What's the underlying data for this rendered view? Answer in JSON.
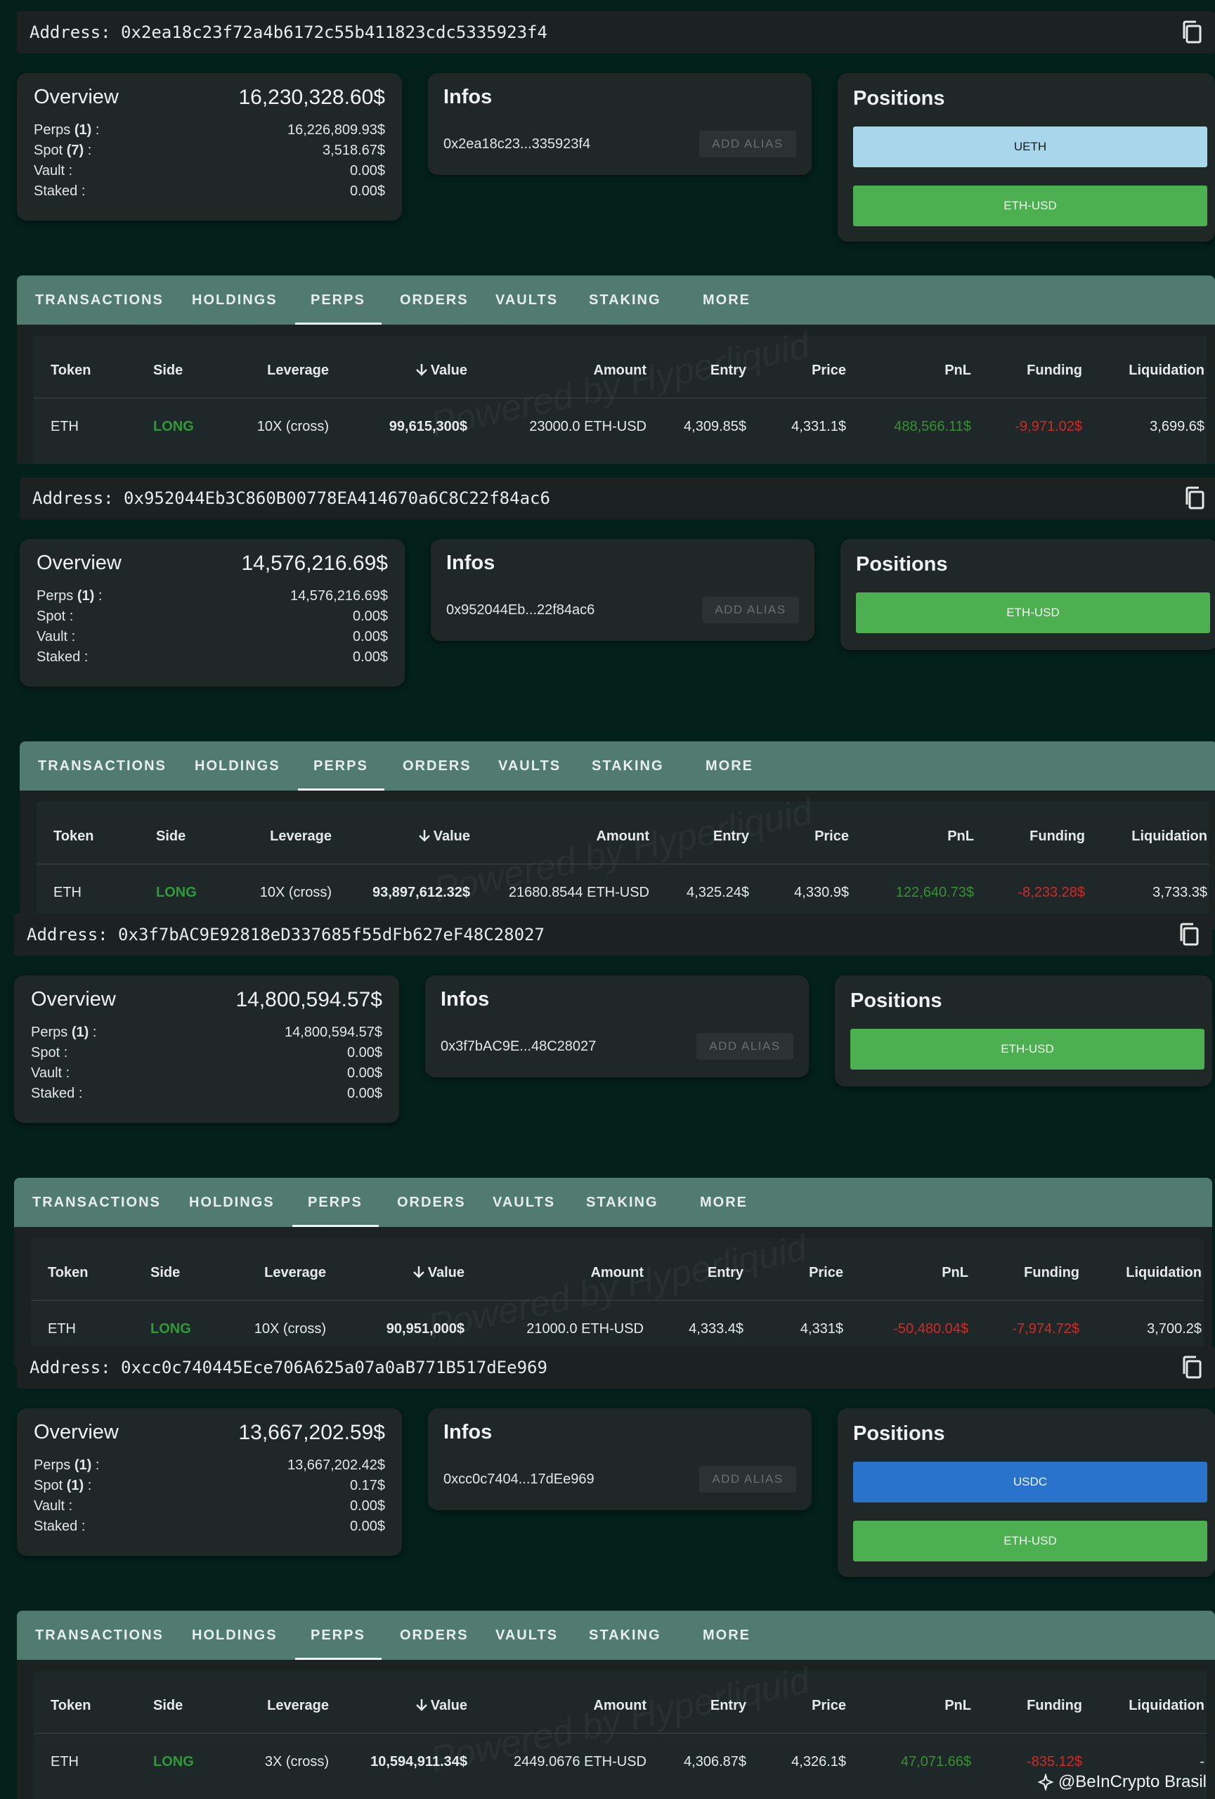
{
  "blocks": [
    {
      "address_line": "Address: 0x2ea18c23f72a4b6172c55b411823cdc5335923f4",
      "overview": {
        "title": "Overview",
        "total": "16,230,328.60$",
        "rows": [
          {
            "name": "Perps",
            "count": "(1)",
            "suffix": " :",
            "value": "16,226,809.93$"
          },
          {
            "name": "Spot",
            "count": "(7)",
            "suffix": " :",
            "value": "3,518.67$"
          },
          {
            "name": "Vault",
            "count": "",
            "suffix": " :",
            "value": "0.00$"
          },
          {
            "name": "Staked",
            "count": "",
            "suffix": " :",
            "value": "0.00$"
          }
        ]
      },
      "infos": {
        "title": "Infos",
        "short_address": "0x2ea18c23...335923f4",
        "alias_button": "ADD ALIAS"
      },
      "positions": {
        "title": "Positions",
        "items": [
          {
            "label": "UETH",
            "color": "#a8d6ea",
            "text_color": "#1a1a1a"
          },
          {
            "label": "ETH-USD",
            "color": "#4caf50",
            "text_color": "#f4f7f4"
          }
        ]
      },
      "row": {
        "token": "ETH",
        "side": "LONG",
        "leverage": "10X (cross)",
        "value": "99,615,300$",
        "amount": "23000.0 ETH-USD",
        "entry": "4,309.85$",
        "price": "4,331.1$",
        "pnl": "488,566.11$",
        "pnl_sign": "positive",
        "funding": "-9,971.02$",
        "liquidation": "3,699.6$"
      }
    },
    {
      "address_line": "Address: 0x952044Eb3C860B00778EA414670a6C8C22f84ac6",
      "overview": {
        "title": "Overview",
        "total": "14,576,216.69$",
        "rows": [
          {
            "name": "Perps",
            "count": "(1)",
            "suffix": " :",
            "value": "14,576,216.69$"
          },
          {
            "name": "Spot",
            "count": "",
            "suffix": " :",
            "value": "0.00$"
          },
          {
            "name": "Vault",
            "count": "",
            "suffix": " :",
            "value": "0.00$"
          },
          {
            "name": "Staked",
            "count": "",
            "suffix": " :",
            "value": "0.00$"
          }
        ]
      },
      "infos": {
        "title": "Infos",
        "short_address": "0x952044Eb...22f84ac6",
        "alias_button": "ADD ALIAS"
      },
      "positions": {
        "title": "Positions",
        "items": [
          {
            "label": "ETH-USD",
            "color": "#4caf50",
            "text_color": "#f4f7f4"
          }
        ]
      },
      "row": {
        "token": "ETH",
        "side": "LONG",
        "leverage": "10X (cross)",
        "value": "93,897,612.32$",
        "amount": "21680.8544 ETH-USD",
        "entry": "4,325.24$",
        "price": "4,330.9$",
        "pnl": "122,640.73$",
        "pnl_sign": "positive",
        "funding": "-8,233.28$",
        "liquidation": "3,733.3$"
      }
    },
    {
      "address_line": "Address: 0x3f7bAC9E92818eD337685f55dFb627eF48C28027",
      "overview": {
        "title": "Overview",
        "total": "14,800,594.57$",
        "rows": [
          {
            "name": "Perps",
            "count": "(1)",
            "suffix": " :",
            "value": "14,800,594.57$"
          },
          {
            "name": "Spot",
            "count": "",
            "suffix": " :",
            "value": "0.00$"
          },
          {
            "name": "Vault",
            "count": "",
            "suffix": " :",
            "value": "0.00$"
          },
          {
            "name": "Staked",
            "count": "",
            "suffix": " :",
            "value": "0.00$"
          }
        ]
      },
      "infos": {
        "title": "Infos",
        "short_address": "0x3f7bAC9E...48C28027",
        "alias_button": "ADD ALIAS"
      },
      "positions": {
        "title": "Positions",
        "items": [
          {
            "label": "ETH-USD",
            "color": "#4caf50",
            "text_color": "#f4f7f4"
          }
        ]
      },
      "row": {
        "token": "ETH",
        "side": "LONG",
        "leverage": "10X (cross)",
        "value": "90,951,000$",
        "amount": "21000.0 ETH-USD",
        "entry": "4,333.4$",
        "price": "4,331$",
        "pnl": "-50,480.04$",
        "pnl_sign": "negative",
        "funding": "-7,974.72$",
        "liquidation": "3,700.2$"
      }
    },
    {
      "address_line": "Address: 0xcc0c740445Ece706A625a07a0aB771B517dEe969",
      "overview": {
        "title": "Overview",
        "total": "13,667,202.59$",
        "rows": [
          {
            "name": "Perps",
            "count": "(1)",
            "suffix": " :",
            "value": "13,667,202.42$"
          },
          {
            "name": "Spot",
            "count": "(1)",
            "suffix": " :",
            "value": "0.17$"
          },
          {
            "name": "Vault",
            "count": "",
            "suffix": " :",
            "value": "0.00$"
          },
          {
            "name": "Staked",
            "count": "",
            "suffix": " :",
            "value": "0.00$"
          }
        ]
      },
      "infos": {
        "title": "Infos",
        "short_address": "0xcc0c7404...17dEe969",
        "alias_button": "ADD ALIAS"
      },
      "positions": {
        "title": "Positions",
        "items": [
          {
            "label": "USDC",
            "color": "#2a73cc",
            "text_color": "#f4f7f4"
          },
          {
            "label": "ETH-USD",
            "color": "#4caf50",
            "text_color": "#f4f7f4"
          }
        ]
      },
      "row": {
        "token": "ETH",
        "side": "LONG",
        "leverage": "3X (cross)",
        "value": "10,594,911.34$",
        "amount": "2449.0676 ETH-USD",
        "entry": "4,306.87$",
        "price": "4,326.1$",
        "pnl": "47,071.66$",
        "pnl_sign": "positive",
        "funding": "-835.12$",
        "liquidation": "-"
      }
    }
  ],
  "tabs": [
    "TRANSACTIONS",
    "HOLDINGS",
    "PERPS",
    "ORDERS",
    "VAULTS",
    "STAKING",
    "MORE"
  ],
  "active_tab": "PERPS",
  "columns": [
    "Token",
    "Side",
    "Leverage",
    "Value",
    "Amount",
    "Entry",
    "Price",
    "PnL",
    "Funding",
    "Liquidation"
  ],
  "sort_column": "Value",
  "watermark": "Powered by Hyperliquid",
  "footer": "@BeInCrypto Brasil",
  "colors": {
    "background": "#04201b",
    "tab_bar": "#527b70",
    "long": "#2f9a38",
    "negative": "#d12a26"
  }
}
